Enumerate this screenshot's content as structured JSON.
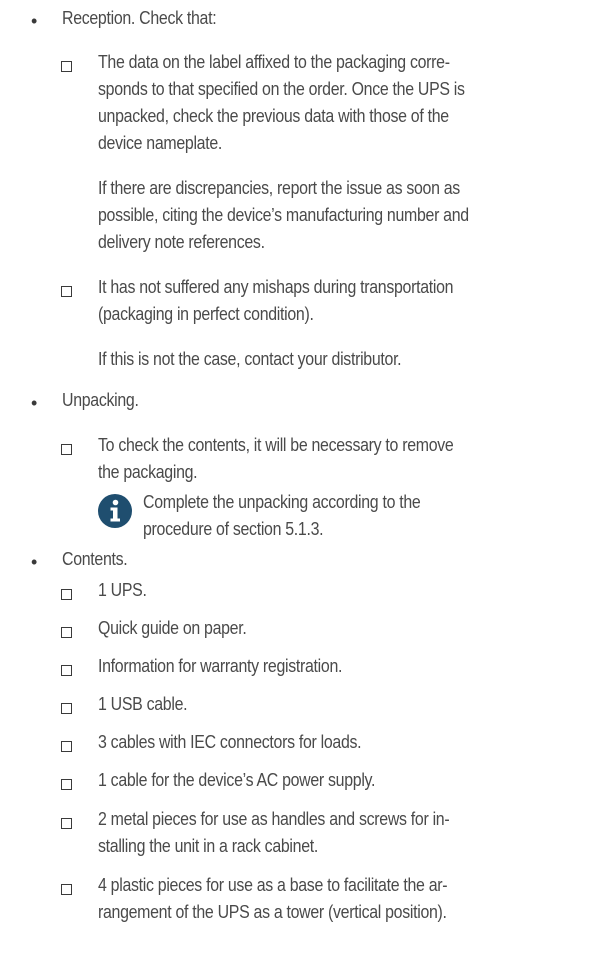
{
  "sections": [
    {
      "title": "Reception. Check that:",
      "items": [
        {
          "lines": [
            "The data on the label affixed to the packaging corre-",
            "sponds to that specified on the order. Once the UPS is",
            "unpacked, check the previous data with those of the",
            "device nameplate."
          ],
          "followup": [
            "If there are discrepancies, report the issue as soon as",
            "possible, citing the device’s manufacturing number and",
            "delivery note references."
          ]
        },
        {
          "lines": [
            "It has not suffered any mishaps during transportation",
            "(packaging in perfect condition)."
          ],
          "followup": [
            "If this is not the case, contact your distributor."
          ]
        }
      ]
    },
    {
      "title": "Unpacking.",
      "items": [
        {
          "lines": [
            "To check the contents, it will be necessary to remove",
            "the packaging."
          ],
          "note": {
            "icon": "info-icon",
            "color": "#1f4e6f",
            "lines": [
              "Complete the unpacking according to the",
              "procedure of section 5.1.3."
            ]
          }
        }
      ]
    },
    {
      "title": "Contents.",
      "items": [
        {
          "lines": [
            "1 UPS."
          ]
        },
        {
          "lines": [
            "Quick guide on paper."
          ]
        },
        {
          "lines": [
            "Information for warranty registration."
          ]
        },
        {
          "lines": [
            "1 USB cable."
          ]
        },
        {
          "lines": [
            "3 cables with IEC connectors for loads."
          ]
        },
        {
          "lines": [
            "1 cable for the device’s AC power supply."
          ]
        },
        {
          "lines": [
            "2 metal pieces for use as handles and screws for in-",
            "stalling the unit in a rack cabinet."
          ]
        },
        {
          "lines": [
            "4 plastic pieces for use as a base to facilitate the ar-",
            "rangement of the UPS as a tower (vertical position)."
          ]
        }
      ]
    }
  ]
}
